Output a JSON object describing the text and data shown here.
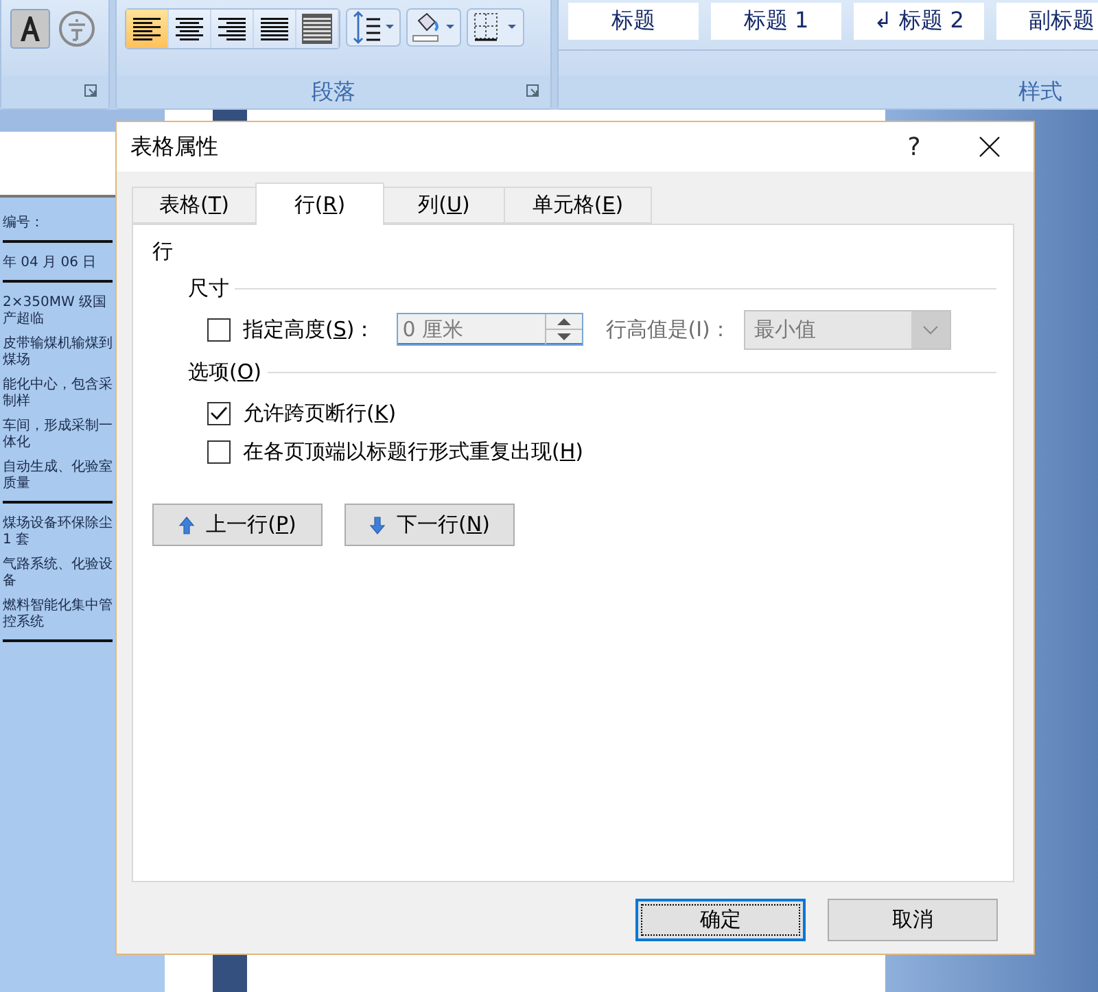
{
  "ribbon": {
    "paragraph": {
      "label": "段落",
      "align_buttons": [
        {
          "kind": "left",
          "selected": true
        },
        {
          "kind": "center",
          "selected": false
        },
        {
          "kind": "right",
          "selected": false
        },
        {
          "kind": "justify",
          "selected": false
        },
        {
          "kind": "distributed",
          "selected": false
        }
      ]
    },
    "styles": {
      "label": "样式",
      "items": [
        {
          "label": "标题"
        },
        {
          "label": "标题 1"
        },
        {
          "label": "↲ 标题 2"
        },
        {
          "label": "副标题"
        }
      ]
    }
  },
  "document": {
    "lines": [
      {
        "text": "编号：",
        "rule_after": true
      },
      {
        "text": "年 04 月 06 日",
        "rule_after": true
      },
      {
        "text": "2×350MW 级国产超临",
        "rule_after": false
      },
      {
        "text": "皮带输煤机输煤到煤场",
        "rule_after": false
      },
      {
        "text": "能化中心，包含采制样",
        "rule_after": false
      },
      {
        "text": "车间，形成采制一体化",
        "rule_after": false
      },
      {
        "text": "自动生成、化验室质量",
        "rule_after": true
      },
      {
        "text": "煤场设备环保除尘 1 套",
        "rule_after": false
      },
      {
        "text": "气路系统、化验设备",
        "rule_after": false
      },
      {
        "text": "燃料智能化集中管控系统",
        "rule_after": true
      }
    ]
  },
  "dialog": {
    "title": "表格属性",
    "help": "?",
    "tabs": [
      {
        "label": "表格(T)",
        "accel": true,
        "selected": false
      },
      {
        "label": "行(R)",
        "accel": true,
        "selected": true
      },
      {
        "label": "列(U)",
        "accel": true,
        "selected": false
      },
      {
        "label": "单元格(E)",
        "accel": true,
        "selected": false
      }
    ],
    "section_title": "行",
    "size": {
      "heading": "尺寸",
      "specify_height": {
        "label": "指定高度(S)：",
        "accel": true,
        "checked": false
      },
      "height": {
        "value": "0 厘米",
        "disabled": true
      },
      "height_rule": {
        "label": "行高值是(I)：",
        "accel": false,
        "disabled": true
      },
      "rule_select": {
        "value": "最小值",
        "disabled": true
      }
    },
    "options": {
      "heading": "选项(O)",
      "accel": true,
      "items": [
        {
          "label": "允许跨页断行(K)",
          "accel": true,
          "checked": true
        },
        {
          "label": "在各页顶端以标题行形式重复出现(H)",
          "accel": true,
          "checked": false
        }
      ]
    },
    "nav_buttons": [
      {
        "label": "上一行(P)",
        "accel": true,
        "kind": "up"
      },
      {
        "label": "下一行(N)",
        "accel": true,
        "kind": "down"
      }
    ],
    "buttons": [
      {
        "label": "确定",
        "default": true
      },
      {
        "label": "取消",
        "default": false
      }
    ]
  }
}
